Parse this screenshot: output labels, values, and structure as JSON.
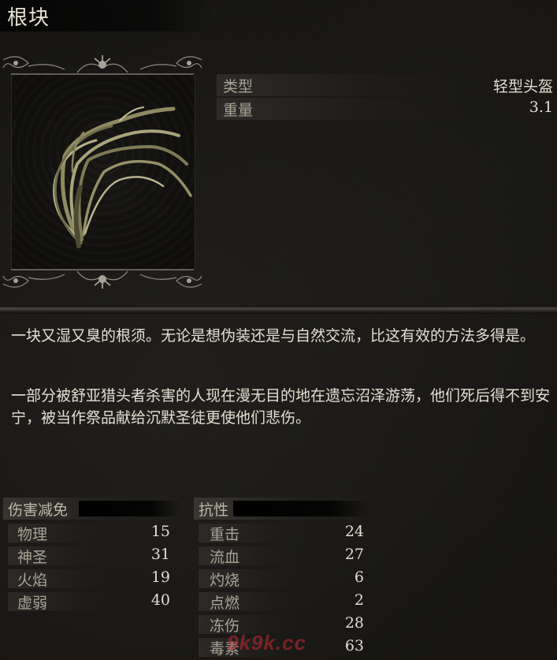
{
  "item": {
    "name": "根块",
    "stats": [
      {
        "label": "类型",
        "value": "轻型头盔"
      },
      {
        "label": "重量",
        "value": "3.1"
      }
    ],
    "description": [
      "一块又湿又臭的根须。无论是想伪装还是与自然交流，比这有效的方法多得是。",
      "一部分被舒亚猎头者杀害的人现在漫无目的地在遗忘沼泽游荡，他们死后得不到安宁，被当作祭品献给沉默圣徒更使他们悲伤。"
    ]
  },
  "damage_negation": {
    "title": "伤害减免",
    "rows": [
      {
        "label": "物理",
        "value": "15"
      },
      {
        "label": "神圣",
        "value": "31"
      },
      {
        "label": "火焰",
        "value": "19"
      },
      {
        "label": "虚弱",
        "value": "40"
      }
    ]
  },
  "resistance": {
    "title": "抗性",
    "rows": [
      {
        "label": "重击",
        "value": "24"
      },
      {
        "label": "流血",
        "value": "27"
      },
      {
        "label": "灼烧",
        "value": "6"
      },
      {
        "label": "点燃",
        "value": "2"
      },
      {
        "label": "冻伤",
        "value": "28"
      },
      {
        "label": "毒素",
        "value": "63"
      }
    ]
  },
  "watermark": "9k9k.cc",
  "icons": {
    "item_image": "root-strands-icon",
    "frame": "ornate-frame-icon"
  }
}
